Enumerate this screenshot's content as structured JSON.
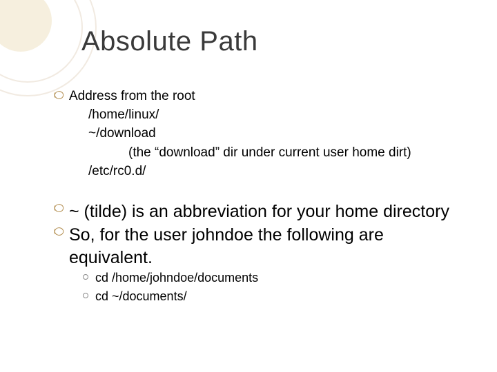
{
  "title": "Absolute Path",
  "section1": {
    "lead": "Address from the root",
    "lines": {
      "l1": "/home/linux/",
      "l2": "~/download",
      "l3": "(the “download” dir under current user home dirt)",
      "l4": "/etc/rc0.d/"
    }
  },
  "section2": {
    "b1": "~ (tilde) is an abbreviation for your home directory",
    "b2": "So, for the user johndoe the following are",
    "b2_cont": "equivalent.",
    "subs": {
      "s1": "cd /home/johndoe/documents",
      "s2": "cd ~/documents/"
    }
  }
}
